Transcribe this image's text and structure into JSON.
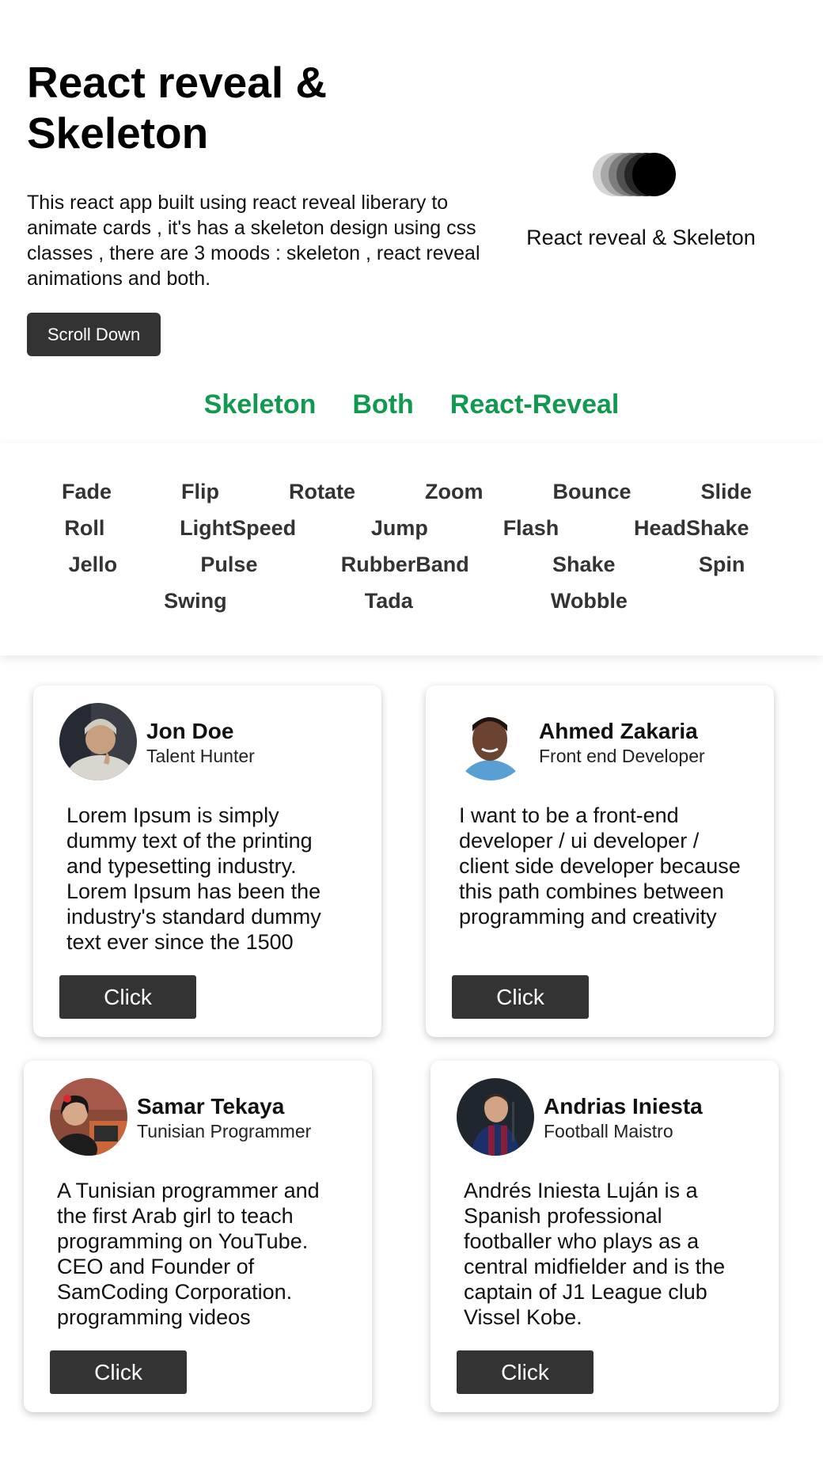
{
  "hero": {
    "title": "React reveal & Skeleton",
    "description": "This react app built using react reveal liberary to animate cards , it's has a skeleton design using css classes , there are 3 moods : skeleton , react reveal animations and both.",
    "scroll_button": "Scroll Down",
    "logo_caption": "React reveal & Skeleton",
    "logo_icon": "stacked-circles-logo-icon"
  },
  "modes": [
    {
      "label": "Skeleton"
    },
    {
      "label": "Both"
    },
    {
      "label": "React-Reveal"
    }
  ],
  "animations": {
    "row1": [
      "Fade",
      "Flip",
      "Rotate",
      "Zoom",
      "Bounce",
      "Slide"
    ],
    "row2": [
      "Roll",
      "LightSpeed",
      "Jump",
      "Flash",
      "HeadShake"
    ],
    "row3": [
      "Jello",
      "Pulse",
      "RubberBand",
      "Shake",
      "Spin"
    ],
    "row4": [
      "Swing",
      "Tada",
      "Wobble"
    ]
  },
  "cards": [
    {
      "name": "Jon Doe",
      "role": "Talent Hunter",
      "text": "Lorem Ipsum is simply dummy text of the printing and typesetting industry. Lorem Ipsum has been the industry's standard dummy text ever since the 1500",
      "button": "Click"
    },
    {
      "name": "Ahmed Zakaria",
      "role": "Front end Developer",
      "text": "I want to be a front-end developer / ui developer / client side developer because this path combines between programming and creativity",
      "button": "Click"
    },
    {
      "name": "Samar Tekaya",
      "role": "Tunisian Programmer",
      "text": "A Tunisian programmer and the first Arab girl to teach programming on YouTube. CEO and Founder of SamCoding Corporation. programming videos",
      "button": "Click"
    },
    {
      "name": "Andrias Iniesta",
      "role": "Football Maistro",
      "text": "Andrés Iniesta Luján is a Spanish professional footballer who plays as a central midfielder and is the captain of J1 League club Vissel Kobe.",
      "button": "Click"
    }
  ],
  "colors": {
    "accent_green": "#11994f",
    "button_dark": "#333333"
  }
}
